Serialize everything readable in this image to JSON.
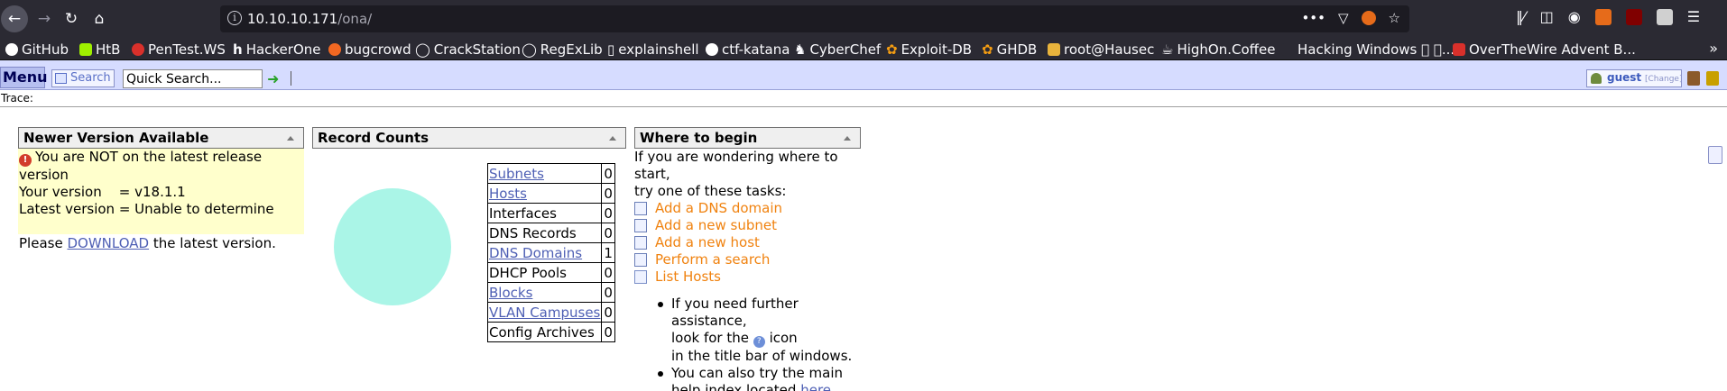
{
  "browser": {
    "url_host": "10.10.10.171",
    "url_path": "/ona/",
    "bookmarks": [
      {
        "label": "GitHub",
        "icon": "github-icon",
        "color": "#ffffff"
      },
      {
        "label": "HtB",
        "icon": "htb-icon",
        "color": "#9fef00"
      },
      {
        "label": "PenTest.WS",
        "icon": "pentestws-icon",
        "color": "#d9302b"
      },
      {
        "label": "HackerOne",
        "icon": "hackerone-icon",
        "color": "#ffffff"
      },
      {
        "label": "bugcrowd",
        "icon": "bugcrowd-icon",
        "color": "#f26822"
      },
      {
        "label": "CrackStation",
        "icon": "globe-icon",
        "color": "#cccccc"
      },
      {
        "label": "RegExLib",
        "icon": "globe-icon",
        "color": "#cccccc"
      },
      {
        "label": "explainshell",
        "icon": "explainshell-icon",
        "color": "#ffffff"
      },
      {
        "label": "ctf-katana",
        "icon": "github-icon",
        "color": "#ffffff"
      },
      {
        "label": "CyberChef",
        "icon": "cyberchef-icon",
        "color": "#ffffff"
      },
      {
        "label": "Exploit-DB",
        "icon": "exploitdb-icon",
        "color": "#f39c12"
      },
      {
        "label": "GHDB",
        "icon": "ghdb-icon",
        "color": "#f39c12"
      },
      {
        "label": "root@Hausec",
        "icon": "hausec-icon",
        "color": "#e8b33c"
      },
      {
        "label": "HighOn.Coffee",
        "icon": "coffee-icon",
        "color": "#ffffff"
      },
      {
        "label": "Hacking Windows ⃞ ⃞...",
        "icon": "blank-icon",
        "color": "#2b2a33"
      },
      {
        "label": "OverTheWire Advent B...",
        "icon": "overthewire-icon",
        "color": "#d9302b"
      }
    ]
  },
  "ona": {
    "menu_label": "Menu",
    "search_label": "Search",
    "quick_search_value": "Quick Search...",
    "user_label": "guest",
    "change_label": "[Change]",
    "trace_label": "Trace:"
  },
  "newer_version": {
    "title": "Newer Version Available",
    "warning": "You are NOT on the latest release version",
    "your_version": "Your version    = v18.1.1",
    "latest_version": "Latest version = Unable to determine",
    "please": "Please",
    "download_link": "DOWNLOAD",
    "tail": "the latest version."
  },
  "record_counts": {
    "title": "Record Counts",
    "rows": [
      {
        "label": "Subnets",
        "count": "0",
        "link": true
      },
      {
        "label": "Hosts",
        "count": "0",
        "link": true
      },
      {
        "label": "Interfaces",
        "count": "0",
        "link": false
      },
      {
        "label": "DNS Records",
        "count": "0",
        "link": false
      },
      {
        "label": "DNS Domains",
        "count": "1",
        "link": true
      },
      {
        "label": "DHCP Pools",
        "count": "0",
        "link": false
      },
      {
        "label": "Blocks",
        "count": "0",
        "link": true
      },
      {
        "label": "VLAN Campuses",
        "count": "0",
        "link": true
      },
      {
        "label": "Config Archives",
        "count": "0",
        "link": false
      }
    ],
    "pie_color": "#aaf5e7"
  },
  "where_to_begin": {
    "title": "Where to begin",
    "intro_1": "If you are wondering where to start,",
    "intro_2": "try one of these tasks:",
    "tasks": [
      {
        "label": "Add a DNS domain",
        "icon": "add-document-icon"
      },
      {
        "label": "Add a new subnet",
        "icon": "add-document-icon"
      },
      {
        "label": "Add a new host",
        "icon": "add-document-icon"
      },
      {
        "label": "Perform a search",
        "icon": "search-form-icon"
      },
      {
        "label": "List Hosts",
        "icon": "list-icon"
      }
    ],
    "bullet_1_a": "If you need further assistance,",
    "bullet_1_b": "look for the",
    "bullet_1_c": "icon",
    "bullet_1_d": "in the title bar of windows.",
    "bullet_2_a": "You can also try the main",
    "bullet_2_b": "help index located",
    "here_link": "here"
  }
}
